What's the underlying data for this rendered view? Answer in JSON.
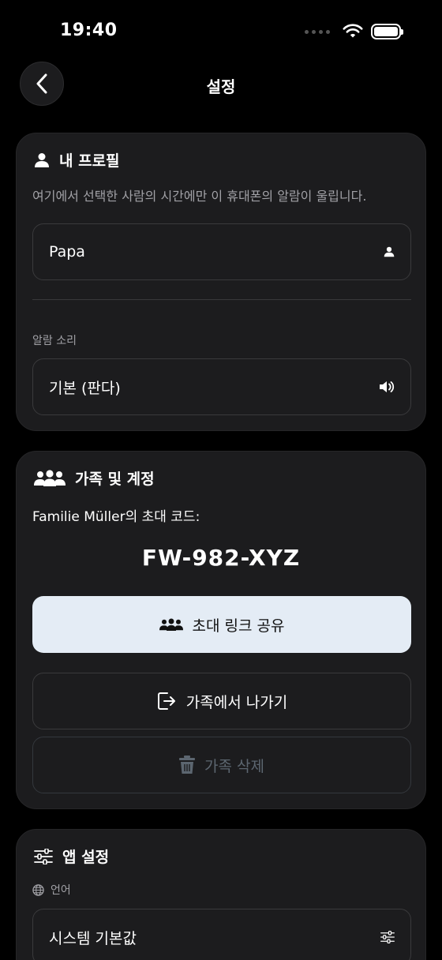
{
  "status": {
    "time": "19:40"
  },
  "nav": {
    "title": "설정"
  },
  "profile": {
    "title": "내 프로필",
    "description": "여기에서 선택한 사람의 시간에만 이 휴대폰의 알람이 울립니다.",
    "person_value": "Papa",
    "alarm_label": "알람 소리",
    "alarm_value": "기본 (판다)"
  },
  "family": {
    "title": "가족 및 계정",
    "invite_label": "Familie Müller의 초대 코드:",
    "code": "FW-982-XYZ",
    "share_button": "초대 링크 공유",
    "leave_button": "가족에서 나가기",
    "delete_button": "가족 삭제"
  },
  "app": {
    "title": "앱 설정",
    "language_label": "언어",
    "language_value": "시스템 기본값"
  },
  "colors": {
    "primary_button_bg": "#e4ecf5",
    "card_bg": "#1c1c1e",
    "disabled_text": "#5c6670"
  }
}
